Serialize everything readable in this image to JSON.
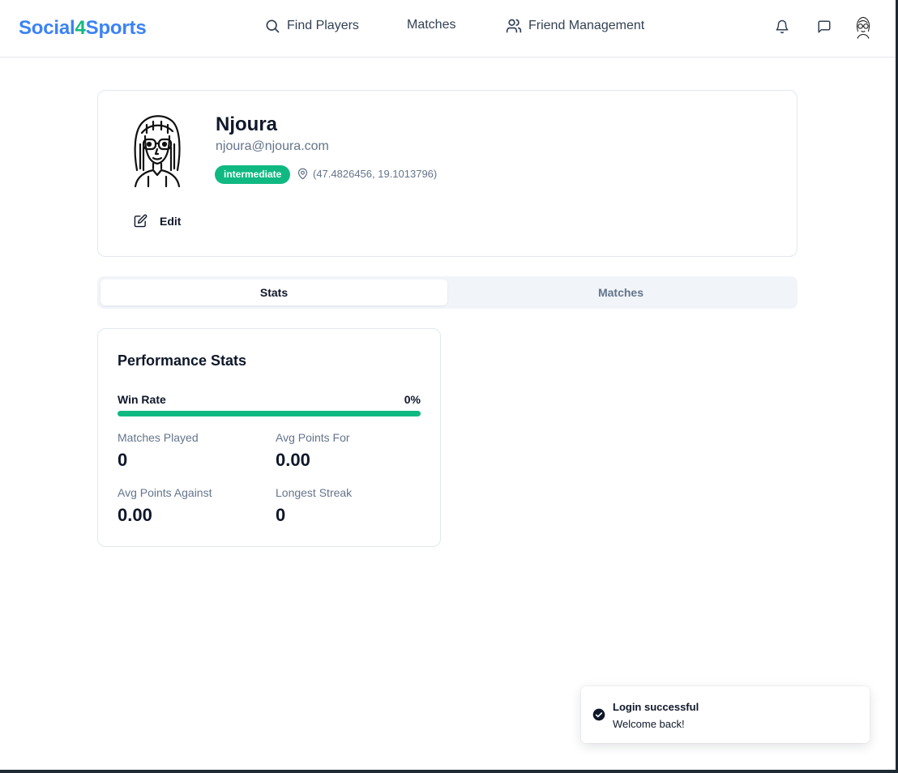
{
  "brand": {
    "part1": "Social",
    "part2": "4",
    "part3": "Sports"
  },
  "nav": {
    "find_players": "Find Players",
    "matches": "Matches",
    "friend_management": "Friend Management"
  },
  "header_icons": [
    "bell-icon",
    "message-square-icon",
    "user-avatar"
  ],
  "profile": {
    "name": "Njoura",
    "email": "njoura@njoura.com",
    "level": "intermediate",
    "location": "(47.4826456, 19.1013796)",
    "edit_label": "Edit"
  },
  "tabs": [
    {
      "label": "Stats",
      "active": true
    },
    {
      "label": "Matches",
      "active": false
    }
  ],
  "stats": {
    "title": "Performance Stats",
    "win_rate_label": "Win Rate",
    "win_rate_value": "0%",
    "win_rate_fraction": 0,
    "items": [
      {
        "label": "Matches Played",
        "value": "0"
      },
      {
        "label": "Avg Points For",
        "value": "0.00"
      },
      {
        "label": "Avg Points Against",
        "value": "0.00"
      },
      {
        "label": "Longest Streak",
        "value": "0"
      }
    ]
  },
  "toast": {
    "title": "Login successful",
    "description": "Welcome back!"
  },
  "colors": {
    "brand_blue": "#3b82f6",
    "brand_green": "#10b981",
    "badge": "#10b981"
  }
}
